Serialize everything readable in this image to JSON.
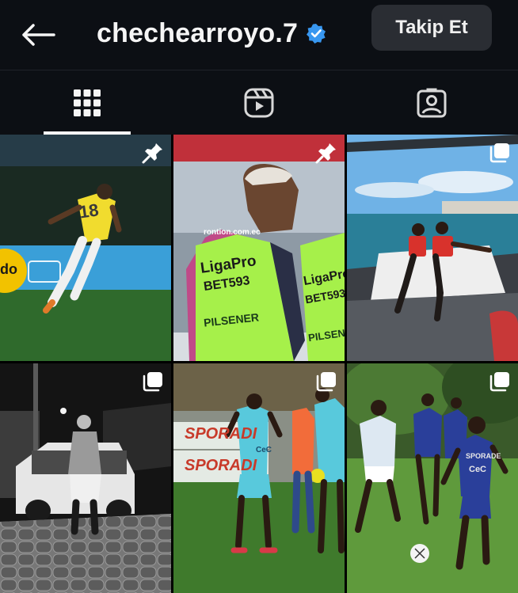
{
  "header": {
    "username": "chechearroyo.7",
    "follow_label": "Takip Et",
    "verified_icon": "verified-badge-icon",
    "back_icon": "arrow-left-icon"
  },
  "tabs": [
    {
      "icon": "grid-icon",
      "active": true
    },
    {
      "icon": "reels-icon",
      "active": false
    },
    {
      "icon": "tagged-icon",
      "active": false
    }
  ],
  "posts": [
    {
      "badge": "pin-icon",
      "jersey_number": "18",
      "ad_text": "do"
    },
    {
      "badge": "pin-icon",
      "bib_brand": "LigaPro",
      "bib_sponsor": "BET593",
      "bib_sponsor_2": "PILSENER",
      "bib_brand_2": "LigaPro",
      "bib_sponsor_3": "BET593",
      "bib_sponsor_4": "PILSEN",
      "sign_text": "rontion.com.ec"
    },
    {
      "badge": "carousel-icon"
    },
    {
      "badge": "carousel-icon"
    },
    {
      "badge": "carousel-icon",
      "banner_text_1": "SPORADI",
      "banner_text_2": "SPORADI",
      "shirt_text": "CeC"
    },
    {
      "badge": "carousel-icon",
      "shirt_text_1": "SPORADE",
      "shirt_text_2": "CeC"
    }
  ],
  "colors": {
    "background": "#0c0f14",
    "follow_button": "#2a2d33",
    "verified": "#3897f0",
    "active_tab": "#f5f5f5"
  }
}
